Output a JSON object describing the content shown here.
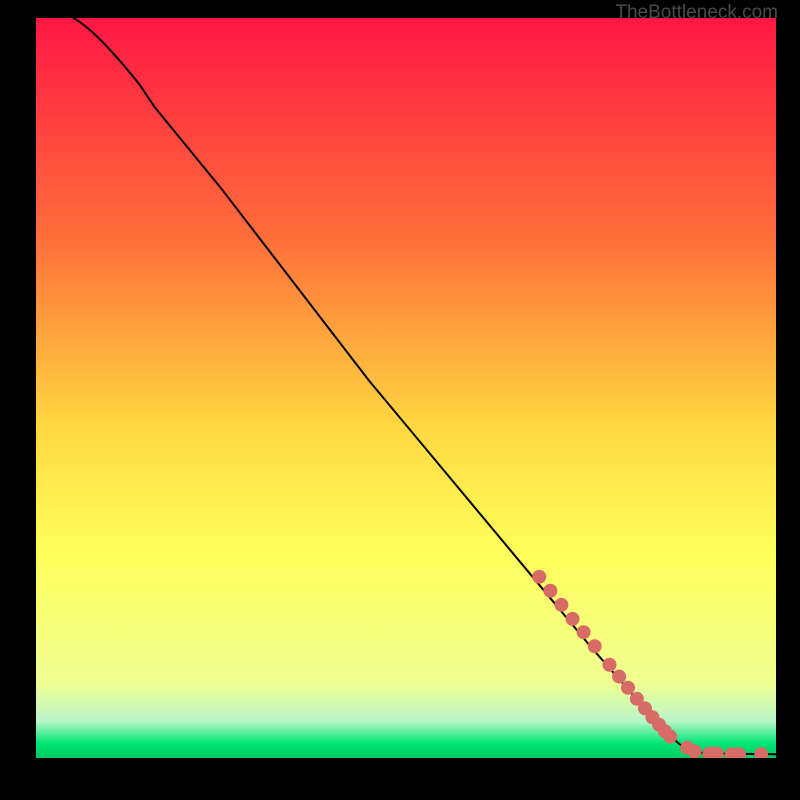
{
  "watermark": "TheBottleneck.com",
  "chart_data": {
    "type": "line",
    "title": "",
    "xlabel": "",
    "ylabel": "",
    "xlim": [
      0,
      100
    ],
    "ylim": [
      0,
      100
    ],
    "gradient_stops": [
      {
        "offset": 0,
        "color": "#ff1744"
      },
      {
        "offset": 30,
        "color": "#ff6f3a"
      },
      {
        "offset": 55,
        "color": "#ffd740"
      },
      {
        "offset": 72,
        "color": "#ffff59"
      },
      {
        "offset": 90,
        "color": "#eeff92"
      },
      {
        "offset": 95,
        "color": "#b9f6ca"
      },
      {
        "offset": 98,
        "color": "#00e676"
      },
      {
        "offset": 100,
        "color": "#00c864"
      }
    ],
    "curve": [
      {
        "x": 5,
        "y": 100
      },
      {
        "x": 8,
        "y": 97
      },
      {
        "x": 12,
        "y": 93
      },
      {
        "x": 16,
        "y": 88
      },
      {
        "x": 25,
        "y": 77
      },
      {
        "x": 35,
        "y": 64
      },
      {
        "x": 45,
        "y": 51
      },
      {
        "x": 55,
        "y": 39
      },
      {
        "x": 65,
        "y": 27
      },
      {
        "x": 75,
        "y": 15
      },
      {
        "x": 82,
        "y": 7
      },
      {
        "x": 86,
        "y": 3
      },
      {
        "x": 88,
        "y": 1.2
      },
      {
        "x": 92,
        "y": 0.6
      },
      {
        "x": 100,
        "y": 0.5
      }
    ],
    "markers": [
      {
        "x": 68,
        "y": 24.5
      },
      {
        "x": 69.5,
        "y": 22.6
      },
      {
        "x": 71,
        "y": 20.7
      },
      {
        "x": 72.5,
        "y": 18.8
      },
      {
        "x": 74,
        "y": 17.0
      },
      {
        "x": 75.5,
        "y": 15.1
      },
      {
        "x": 77.5,
        "y": 12.6
      },
      {
        "x": 78.8,
        "y": 11.0
      },
      {
        "x": 80,
        "y": 9.5
      },
      {
        "x": 81.2,
        "y": 8.0
      },
      {
        "x": 82.3,
        "y": 6.7
      },
      {
        "x": 83.3,
        "y": 5.5
      },
      {
        "x": 84.2,
        "y": 4.5
      },
      {
        "x": 85,
        "y": 3.6
      },
      {
        "x": 85.7,
        "y": 2.9
      },
      {
        "x": 88,
        "y": 1.4
      },
      {
        "x": 89,
        "y": 0.9
      },
      {
        "x": 91,
        "y": 0.6
      },
      {
        "x": 92,
        "y": 0.6
      },
      {
        "x": 94,
        "y": 0.5
      },
      {
        "x": 95,
        "y": 0.5
      },
      {
        "x": 98,
        "y": 0.5
      }
    ],
    "marker_color": "#d96b66",
    "marker_radius": 7
  }
}
